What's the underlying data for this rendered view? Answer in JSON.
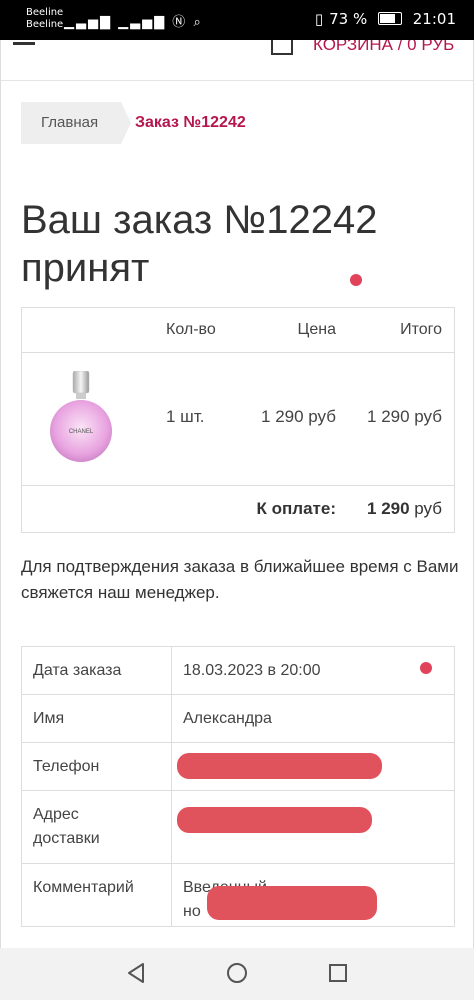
{
  "status_bar": {
    "carrier1": "Beeline",
    "carrier2": "Beeline",
    "battery": "73 %",
    "time": "21:01"
  },
  "header": {
    "cart_label": "КОРЗИНА / 0 РУБ"
  },
  "breadcrumb": {
    "home": "Главная",
    "current": "Заказ №12242"
  },
  "page_title": "Ваш заказ №12242 принят",
  "order_table": {
    "headers": {
      "qty": "Кол-во",
      "price": "Цена",
      "total": "Итого"
    },
    "item": {
      "brand": "CHANEL",
      "qty": "1 шт.",
      "price": "1 290 руб",
      "total": "1 290 руб"
    },
    "payment_label": "К оплате:",
    "payment_amount": "1 290",
    "payment_currency": "руб"
  },
  "confirmation_text": "Для подтверждения заказа в ближайшее время с Вами свяжется наш менеджер.",
  "info": {
    "date_label": "Дата заказа",
    "date_value": "18.03.2023 в 20:00",
    "name_label": "Имя",
    "name_value": "Александра",
    "phone_label": "Телефон",
    "address_label_line1": "Адрес",
    "address_label_line2": "доставки",
    "comment_label": "Комментарий",
    "comment_value_line1": "Введенный",
    "comment_value_line2": "но"
  },
  "colors": {
    "accent": "#b4164d",
    "dot": "#e0435a",
    "redaction": "#e0525c"
  }
}
